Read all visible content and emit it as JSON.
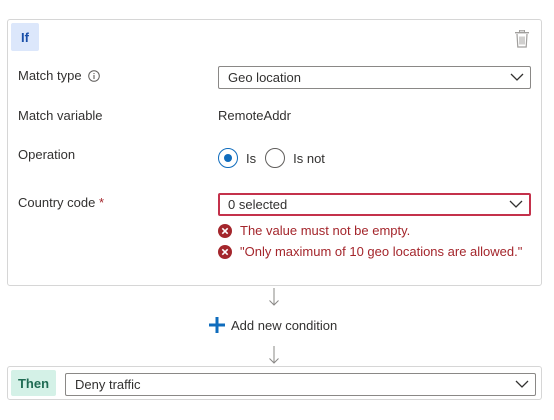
{
  "if_block": {
    "badge": "If",
    "match_type": {
      "label": "Match type",
      "value": "Geo location"
    },
    "match_variable": {
      "label": "Match variable",
      "value": "RemoteAddr"
    },
    "operation": {
      "label": "Operation",
      "options": [
        {
          "label": "Is",
          "checked": true
        },
        {
          "label": "Is not",
          "checked": false
        }
      ]
    },
    "country_code": {
      "label": "Country code",
      "required_mark": "*",
      "value": "0 selected",
      "errors": [
        "The value must not be empty.",
        "\"Only maximum of 10 geo locations are allowed.\""
      ]
    }
  },
  "add_condition": {
    "label": "Add new condition"
  },
  "then_block": {
    "badge": "Then",
    "value": "Deny traffic"
  },
  "colors": {
    "primary": "#0f6cbd",
    "error": "#a4262c",
    "if_badge_bg": "#dce7fb",
    "then_badge_bg": "#d4f1e7"
  },
  "icons": [
    "info-icon",
    "trash-icon",
    "chevron-down-icon",
    "error-icon",
    "arrow-down-icon",
    "plus-icon"
  ]
}
